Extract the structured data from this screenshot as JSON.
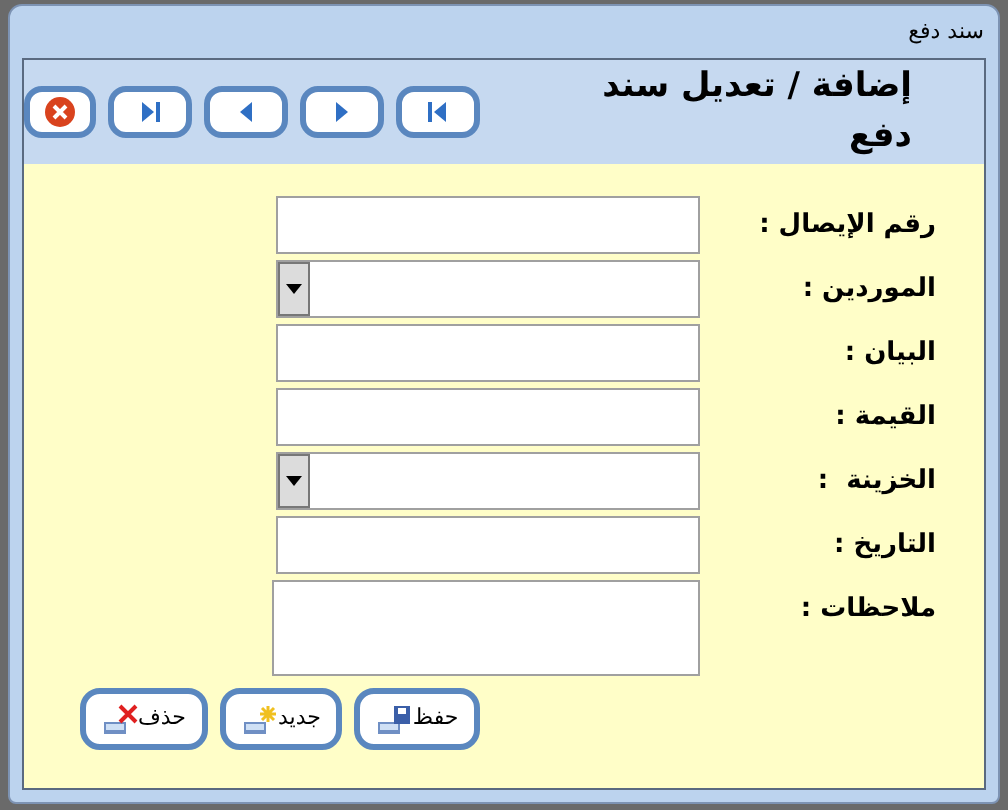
{
  "window": {
    "title": "سند دفع"
  },
  "header": {
    "title": "إضافة / تعديل سند دفع"
  },
  "fields": [
    {
      "label": "رقم الإيصال :",
      "kind": "text"
    },
    {
      "label": "الموردين :",
      "kind": "dropdown"
    },
    {
      "label": "البيان :",
      "kind": "text"
    },
    {
      "label": "القيمة :",
      "kind": "text"
    },
    {
      "label": "الخزينة  :",
      "kind": "dropdown"
    },
    {
      "label": "التاريخ :",
      "kind": "text"
    },
    {
      "label": "ملاحظات :",
      "kind": "textarea"
    }
  ],
  "buttons": [
    {
      "label": "حفظ",
      "kind": "save"
    },
    {
      "label": "جديد",
      "kind": "new"
    },
    {
      "label": "حذف",
      "kind": "delete"
    }
  ]
}
